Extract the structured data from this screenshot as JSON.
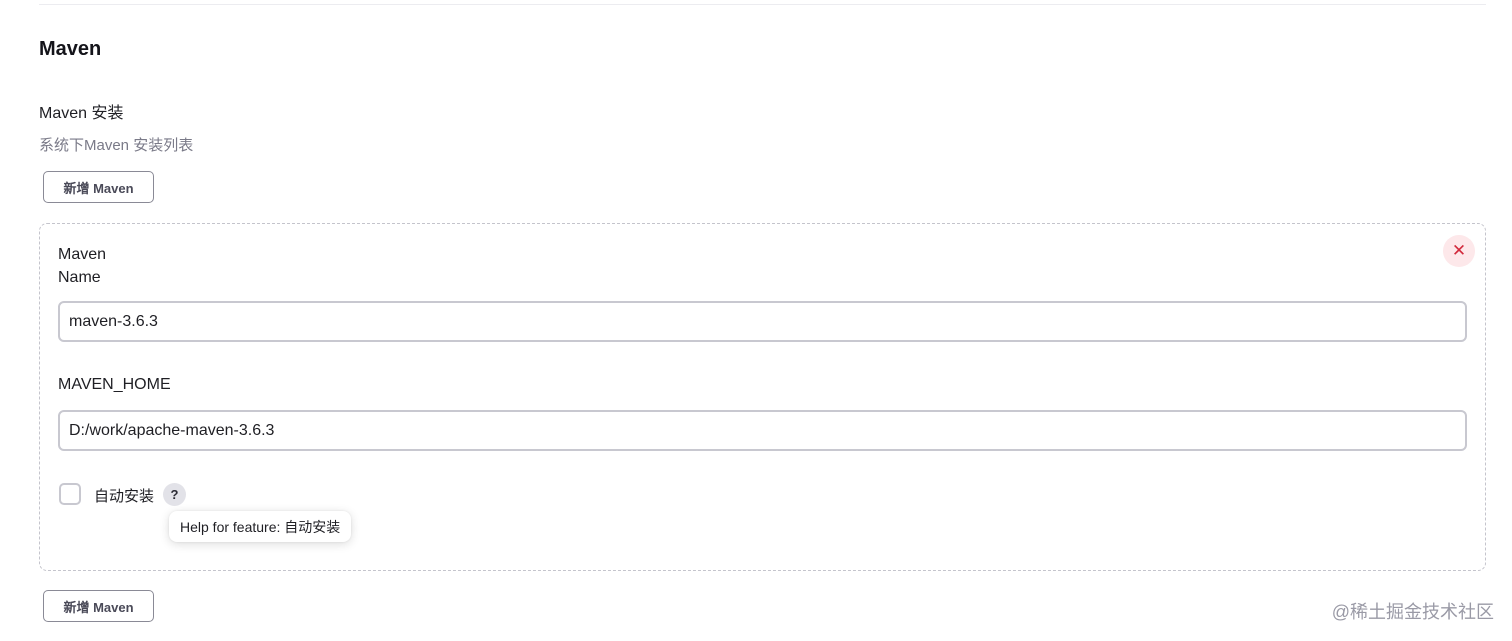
{
  "section": {
    "title": "Maven"
  },
  "installations": {
    "label": "Maven 安装",
    "description": "系统下Maven 安装列表",
    "add_button_label": "新增 Maven"
  },
  "maven_entry": {
    "title_line1": "Maven",
    "title_line2": "Name",
    "delete_glyph": "✕",
    "name_value": "maven-3.6.3",
    "home_label": "MAVEN_HOME",
    "home_value": "D:/work/apache-maven-3.6.3",
    "auto_install": {
      "label": "自动安装",
      "checked": false,
      "help_glyph": "?",
      "tooltip": "Help for feature: 自动安装"
    }
  },
  "watermark": "@稀土掘金技术社区",
  "colors": {
    "delete_bg": "#fde8ea",
    "delete_fg": "#d22a3c",
    "border": "#c8c8d0",
    "description_text": "#7a7a88"
  }
}
